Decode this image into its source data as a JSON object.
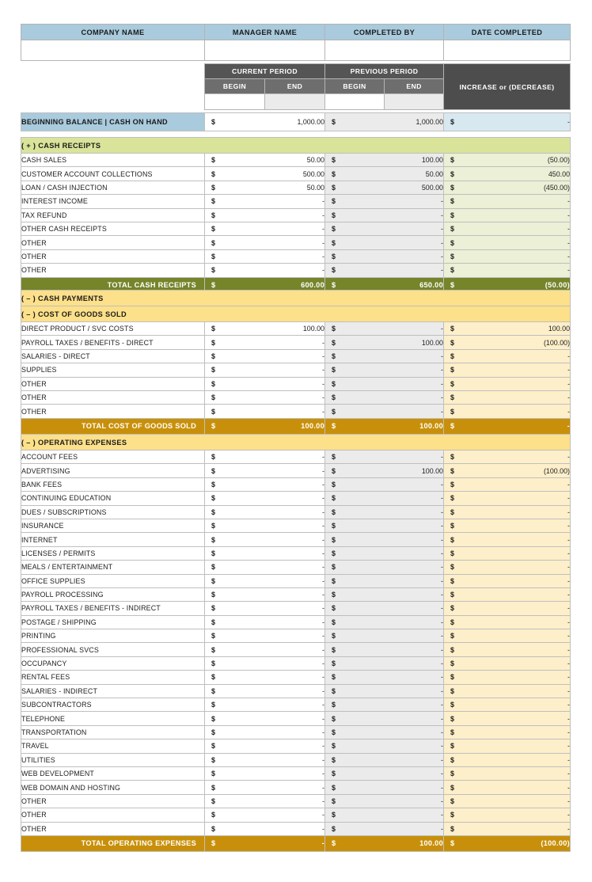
{
  "info_header": {
    "columns": [
      "COMPANY NAME",
      "MANAGER NAME",
      "COMPLETED BY",
      "DATE COMPLETED"
    ],
    "values": [
      "",
      "",
      "",
      ""
    ]
  },
  "period_header": {
    "current_period": "CURRENT PERIOD",
    "previous_period": "PREVIOUS PERIOD",
    "increase_or_decrease": "INCREASE or (DECREASE)",
    "begin": "BEGIN",
    "end": "END",
    "blank_values": [
      "",
      "",
      "",
      ""
    ]
  },
  "beginning_balance": {
    "label": "BEGINNING BALANCE | CASH ON HAND",
    "current": "1,000.00",
    "previous": "1,000.00",
    "change": "-"
  },
  "cash_receipts": {
    "section_label": "( + )  CASH RECEIPTS",
    "total_label": "TOTAL CASH RECEIPTS",
    "rows": [
      {
        "label": "CASH SALES",
        "current": "50.00",
        "previous": "100.00",
        "change": "(50.00)"
      },
      {
        "label": "CUSTOMER ACCOUNT COLLECTIONS",
        "current": "500.00",
        "previous": "50.00",
        "change": "450.00"
      },
      {
        "label": "LOAN / CASH INJECTION",
        "current": "50.00",
        "previous": "500.00",
        "change": "(450.00)"
      },
      {
        "label": "INTEREST INCOME",
        "current": "-",
        "previous": "-",
        "change": "-"
      },
      {
        "label": "TAX REFUND",
        "current": "-",
        "previous": "-",
        "change": "-"
      },
      {
        "label": "OTHER CASH RECEIPTS",
        "current": "-",
        "previous": "-",
        "change": "-"
      },
      {
        "label": "OTHER",
        "current": "-",
        "previous": "-",
        "change": "-"
      },
      {
        "label": "OTHER",
        "current": "-",
        "previous": "-",
        "change": "-"
      },
      {
        "label": "OTHER",
        "current": "-",
        "previous": "-",
        "change": "-"
      }
    ],
    "total": {
      "current": "600.00",
      "previous": "650.00",
      "change": "(50.00)"
    }
  },
  "cash_payments": {
    "section_label": "( – )  CASH PAYMENTS"
  },
  "cost_of_goods_sold": {
    "section_label": "( – )  COST OF GOODS SOLD",
    "total_label": "TOTAL COST OF GOODS SOLD",
    "rows": [
      {
        "label": "DIRECT PRODUCT / SVC COSTS",
        "current": "100.00",
        "previous": "-",
        "change": "100.00"
      },
      {
        "label": "PAYROLL TAXES / BENEFITS - DIRECT",
        "current": "-",
        "previous": "100.00",
        "change": "(100.00)"
      },
      {
        "label": "SALARIES - DIRECT",
        "current": "-",
        "previous": "-",
        "change": "-"
      },
      {
        "label": "SUPPLIES",
        "current": "-",
        "previous": "-",
        "change": "-"
      },
      {
        "label": "OTHER",
        "current": "-",
        "previous": "-",
        "change": "-"
      },
      {
        "label": "OTHER",
        "current": "-",
        "previous": "-",
        "change": "-"
      },
      {
        "label": "OTHER",
        "current": "-",
        "previous": "-",
        "change": "-"
      }
    ],
    "total": {
      "current": "100.00",
      "previous": "100.00",
      "change": "-"
    }
  },
  "operating_expenses": {
    "section_label": "( – )  OPERATING EXPENSES",
    "total_label": "TOTAL OPERATING EXPENSES",
    "rows": [
      {
        "label": "ACCOUNT FEES",
        "current": "-",
        "previous": "-",
        "change": "-"
      },
      {
        "label": "ADVERTISING",
        "current": "-",
        "previous": "100.00",
        "change": "(100.00)"
      },
      {
        "label": "BANK FEES",
        "current": "-",
        "previous": "-",
        "change": "-"
      },
      {
        "label": "CONTINUING EDUCATION",
        "current": "-",
        "previous": "-",
        "change": "-"
      },
      {
        "label": "DUES / SUBSCRIPTIONS",
        "current": "-",
        "previous": "-",
        "change": "-"
      },
      {
        "label": "INSURANCE",
        "current": "-",
        "previous": "-",
        "change": "-"
      },
      {
        "label": "INTERNET",
        "current": "-",
        "previous": "-",
        "change": "-"
      },
      {
        "label": "LICENSES / PERMITS",
        "current": "-",
        "previous": "-",
        "change": "-"
      },
      {
        "label": "MEALS / ENTERTAINMENT",
        "current": "-",
        "previous": "-",
        "change": "-"
      },
      {
        "label": "OFFICE SUPPLIES",
        "current": "-",
        "previous": "-",
        "change": "-"
      },
      {
        "label": "PAYROLL PROCESSING",
        "current": "-",
        "previous": "-",
        "change": "-"
      },
      {
        "label": "PAYROLL TAXES / BENEFITS - INDIRECT",
        "current": "-",
        "previous": "-",
        "change": "-"
      },
      {
        "label": "POSTAGE / SHIPPING",
        "current": "-",
        "previous": "-",
        "change": "-"
      },
      {
        "label": "PRINTING",
        "current": "-",
        "previous": "-",
        "change": "-"
      },
      {
        "label": "PROFESSIONAL SVCS",
        "current": "-",
        "previous": "-",
        "change": "-"
      },
      {
        "label": "OCCUPANCY",
        "current": "-",
        "previous": "-",
        "change": "-"
      },
      {
        "label": "RENTAL FEES",
        "current": "-",
        "previous": "-",
        "change": "-"
      },
      {
        "label": "SALARIES - INDIRECT",
        "current": "-",
        "previous": "-",
        "change": "-"
      },
      {
        "label": "SUBCONTRACTORS",
        "current": "-",
        "previous": "-",
        "change": "-"
      },
      {
        "label": "TELEPHONE",
        "current": "-",
        "previous": "-",
        "change": "-"
      },
      {
        "label": "TRANSPORTATION",
        "current": "-",
        "previous": "-",
        "change": "-"
      },
      {
        "label": "TRAVEL",
        "current": "-",
        "previous": "-",
        "change": "-"
      },
      {
        "label": "UTILITIES",
        "current": "-",
        "previous": "-",
        "change": "-"
      },
      {
        "label": "WEB DEVELOPMENT",
        "current": "-",
        "previous": "-",
        "change": "-"
      },
      {
        "label": "WEB DOMAIN AND HOSTING",
        "current": "-",
        "previous": "-",
        "change": "-"
      },
      {
        "label": "OTHER",
        "current": "-",
        "previous": "-",
        "change": "-"
      },
      {
        "label": "OTHER",
        "current": "-",
        "previous": "-",
        "change": "-"
      },
      {
        "label": "OTHER",
        "current": "-",
        "previous": "-",
        "change": "-"
      }
    ],
    "total": {
      "current": "-",
      "previous": "100.00",
      "change": "(100.00)"
    }
  },
  "currency_symbol": "$",
  "colors": {
    "info_header": "#a9cbdd",
    "period_header": "#555555",
    "receipts_header": "#d9e49a",
    "receipts_fill": "#ebf0d6",
    "receipts_total": "#76842a",
    "payments_header": "#fde08a",
    "payments_fill": "#fdefc9",
    "payments_total": "#c8900a",
    "gray_column": "#ebebeb"
  }
}
